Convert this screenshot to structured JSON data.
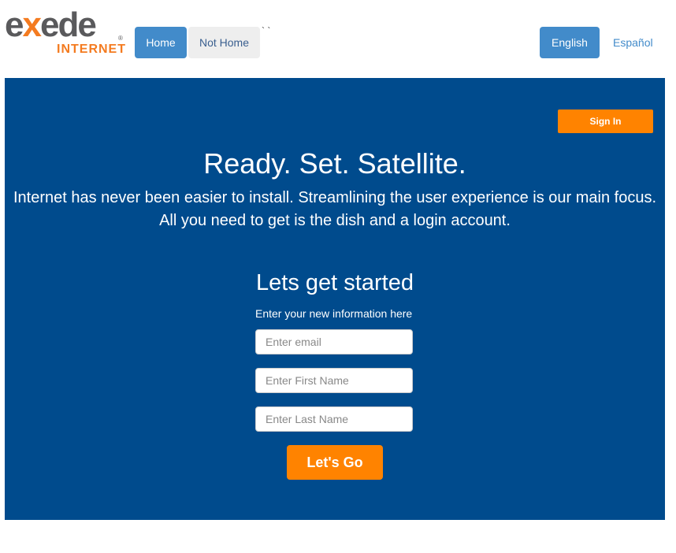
{
  "header": {
    "logo": {
      "word_prefix": "e",
      "word_x": "x",
      "word_suffix": "ede",
      "reg": "®",
      "sub": "INTERNET"
    },
    "tabs": [
      {
        "label": "Home",
        "active": true
      },
      {
        "label": "Not Home",
        "active": false
      }
    ],
    "stray_text": "` `",
    "languages": {
      "english": "English",
      "espanol": "Español"
    }
  },
  "hero": {
    "sign_in": "Sign In",
    "title": "Ready. Set. Satellite.",
    "line1": "Internet has never been easier to install. Streamlining the user experience is our main focus.",
    "line2": "All you need to get is the dish and a login account.",
    "form": {
      "heading": "Lets get started",
      "instructions": "Enter your new information here",
      "email_placeholder": "Enter email",
      "first_name_placeholder": "Enter First Name",
      "last_name_placeholder": "Enter Last Name",
      "submit_label": "Let's Go"
    }
  },
  "colors": {
    "hero_bg": "#004b8d",
    "accent_orange": "#ff8300",
    "tab_blue": "#428bca",
    "logo_gray": "#5a5a5c"
  }
}
